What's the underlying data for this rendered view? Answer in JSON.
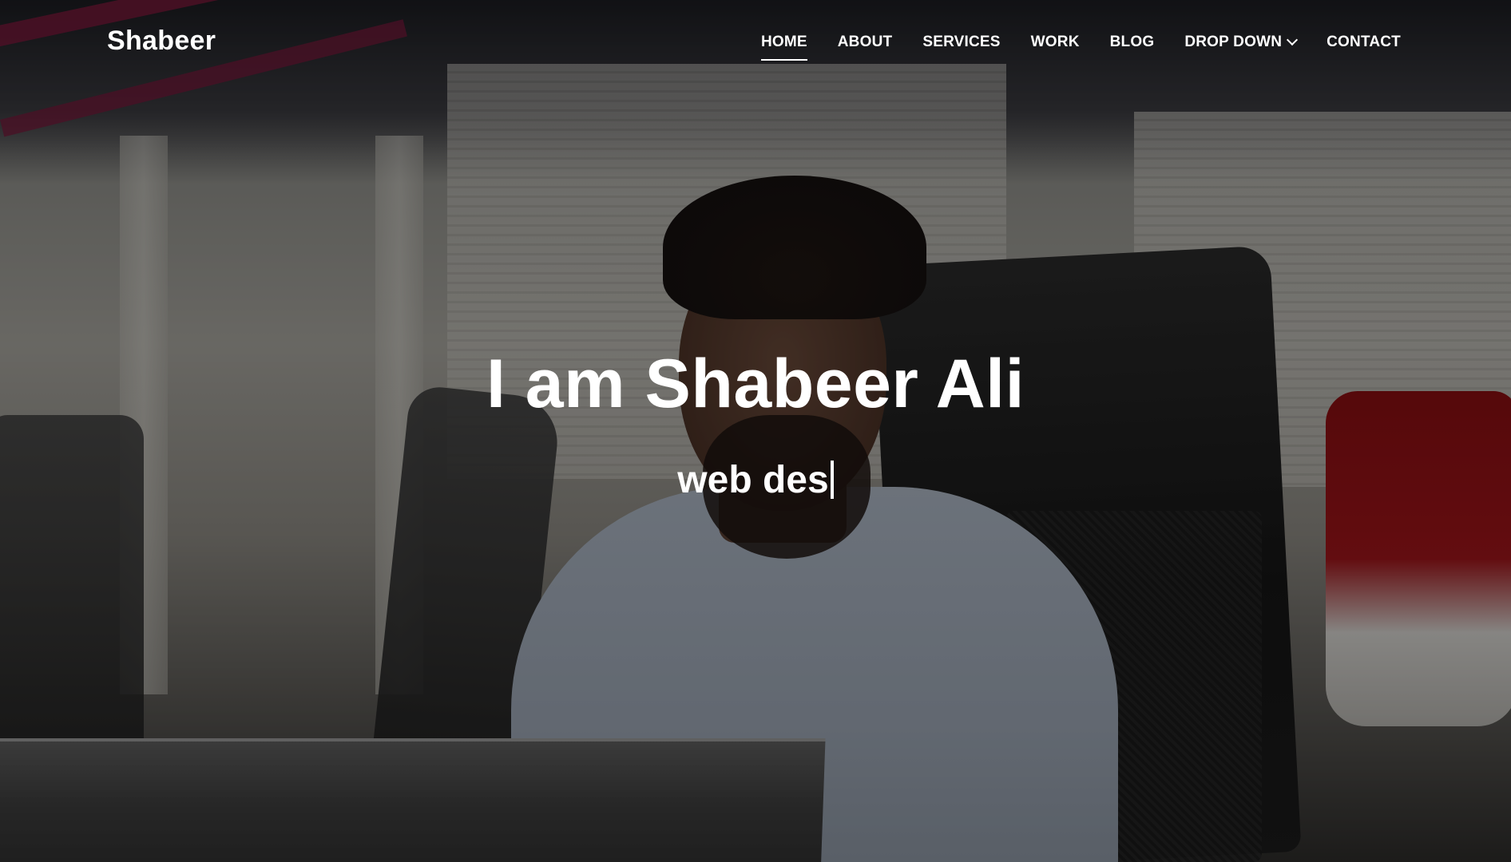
{
  "brand": {
    "name": "Shabeer"
  },
  "nav": {
    "items": [
      {
        "label": "HOME",
        "active": true
      },
      {
        "label": "ABOUT"
      },
      {
        "label": "SERVICES"
      },
      {
        "label": "WORK"
      },
      {
        "label": "BLOG"
      },
      {
        "label": "DROP DOWN",
        "has_dropdown": true
      },
      {
        "label": "CONTACT"
      }
    ]
  },
  "hero": {
    "title": "I am Shabeer Ali",
    "typed_text": "web des"
  },
  "icons": {
    "dropdown": "chevron-down-icon",
    "cursor": "text-cursor-icon"
  },
  "colors": {
    "text": "#ffffff",
    "overlay": "#000000"
  }
}
